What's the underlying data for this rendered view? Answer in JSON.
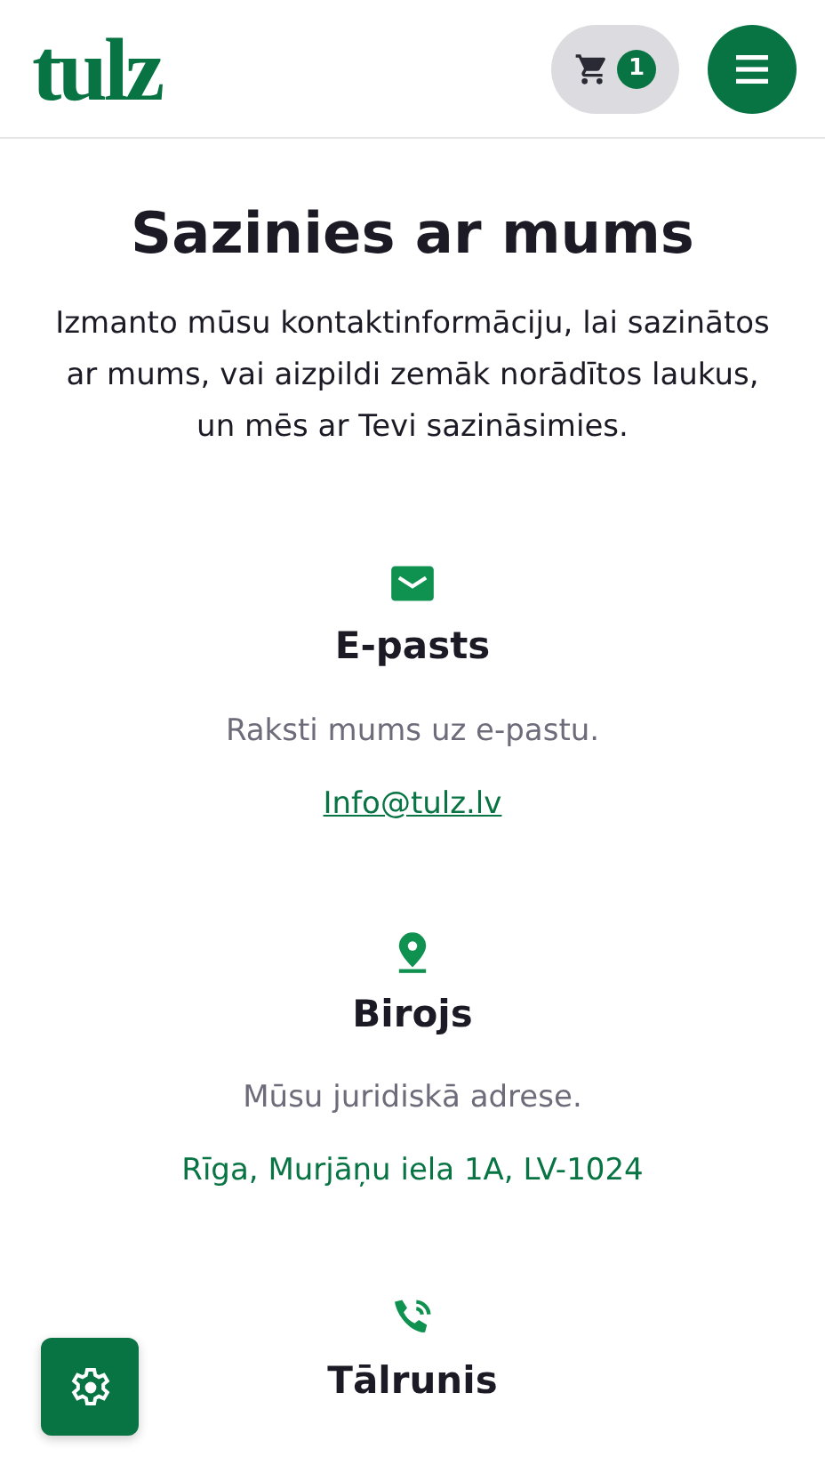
{
  "header": {
    "logo": "tulz",
    "cart_count": "1"
  },
  "title": "Sazinies ar mums",
  "intro": "Izmanto mūsu kontaktinformāciju, lai sazinātos ar mums, vai aizpildi zemāk norādītos laukus, un mēs ar Tevi sazināsimies.",
  "contacts": [
    {
      "kind": "email",
      "title": "E-pasts",
      "description": "Raksti mums uz e-pastu.",
      "value": "Info@tulz.lv",
      "underlined": true
    },
    {
      "kind": "address",
      "title": "Birojs",
      "description": "Mūsu juridiskā adrese.",
      "value": "Rīga, Murjāņu iela 1A, LV-1024",
      "underlined": false
    },
    {
      "kind": "phone",
      "title": "Tālrunis"
    }
  ]
}
